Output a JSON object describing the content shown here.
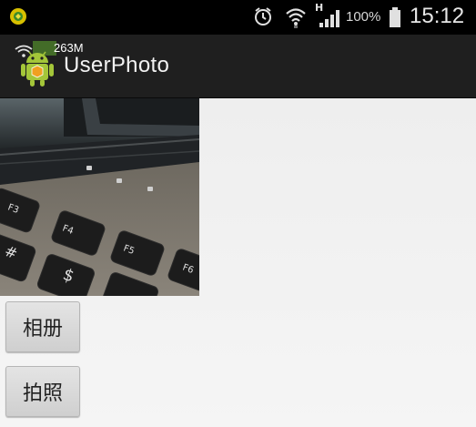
{
  "status_bar": {
    "network_type": "H",
    "battery_percent": "100%",
    "time": "15:12",
    "icons": [
      "notification-icon",
      "alarm-icon",
      "wifi-icon",
      "signal-icon",
      "battery-icon"
    ]
  },
  "action_bar": {
    "title": "UserPhoto",
    "memory_badge": "263M",
    "icon": "android-app-icon"
  },
  "main": {
    "photo": "laptop-keyboard-photo",
    "buttons": {
      "album_label": "相册",
      "camera_label": "拍照"
    }
  },
  "colors": {
    "status_bar_bg": "#000000",
    "action_bar_bg": "#1f1f1f",
    "background": "#f0f0f0",
    "android_green": "#a4c639"
  }
}
